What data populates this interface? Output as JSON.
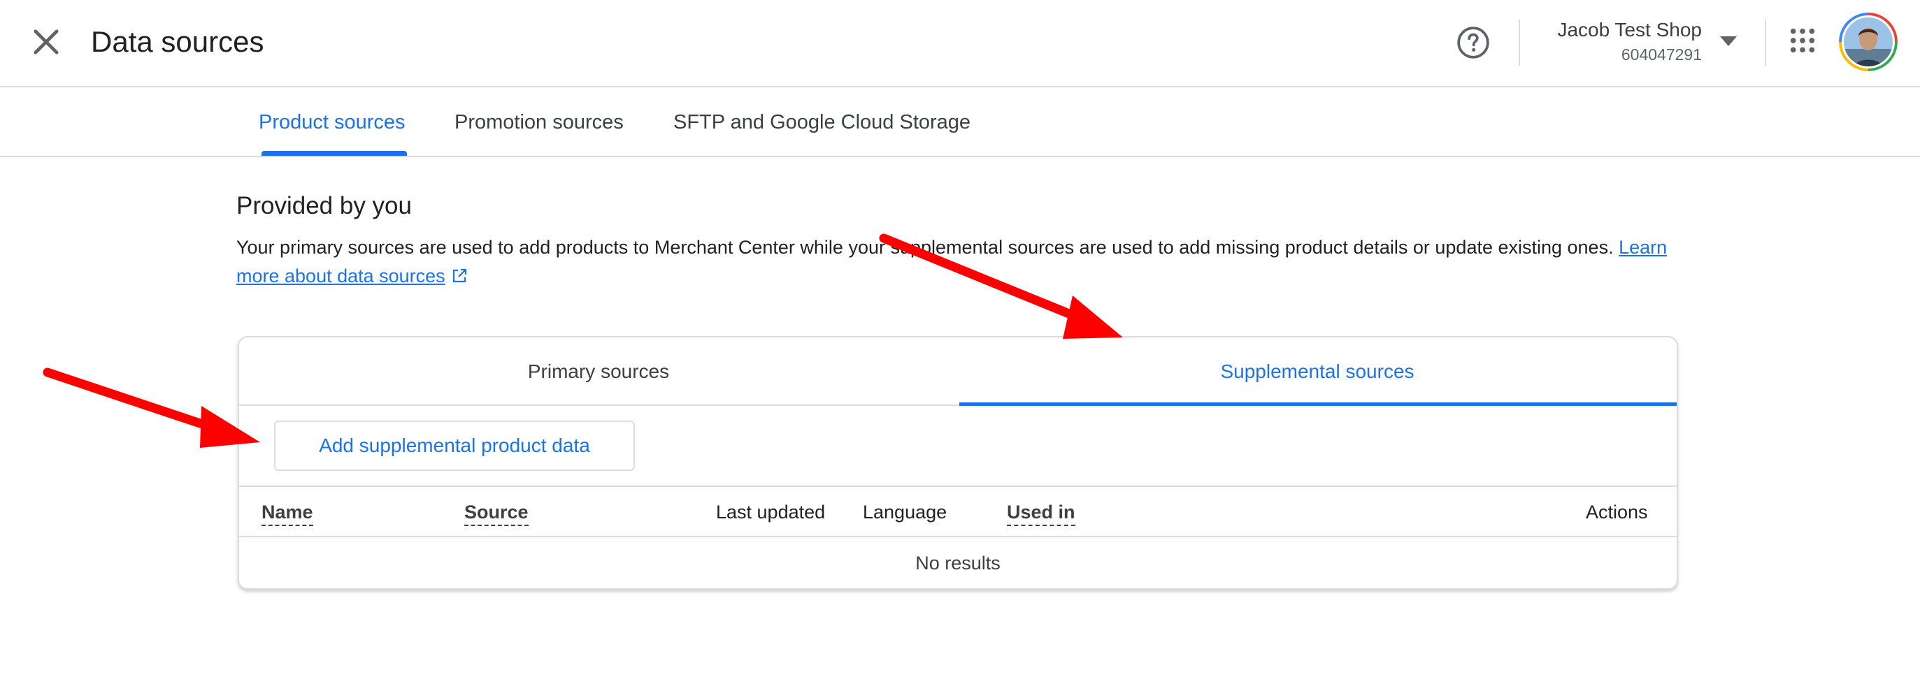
{
  "header": {
    "title": "Data sources",
    "close_icon": "close-icon",
    "help_icon": "help-circle-icon",
    "account": {
      "name": "Jacob Test Shop",
      "id": "604047291"
    },
    "apps_icon": "apps-grid-icon"
  },
  "nav_tabs": [
    {
      "label": "Product sources",
      "active": true
    },
    {
      "label": "Promotion sources",
      "active": false
    },
    {
      "label": "SFTP and Google Cloud Storage",
      "active": false
    }
  ],
  "section": {
    "heading": "Provided by you",
    "description": "Your primary sources are used to add products to Merchant Center while your supplemental sources are used to add missing product details or update existing ones.",
    "learn_more": "Learn more about data sources"
  },
  "card": {
    "tabs": [
      {
        "label": "Primary sources",
        "active": false
      },
      {
        "label": "Supplemental sources",
        "active": true
      }
    ],
    "add_button": "Add supplemental product data",
    "columns": [
      "Name",
      "Source",
      "Last updated",
      "Language",
      "Used in",
      "Actions"
    ],
    "empty_text": "No results"
  },
  "colors": {
    "accent": "#1a73e8",
    "text": "#3c4043",
    "border": "#dadce0",
    "annotation_arrow": "#ff0000"
  }
}
